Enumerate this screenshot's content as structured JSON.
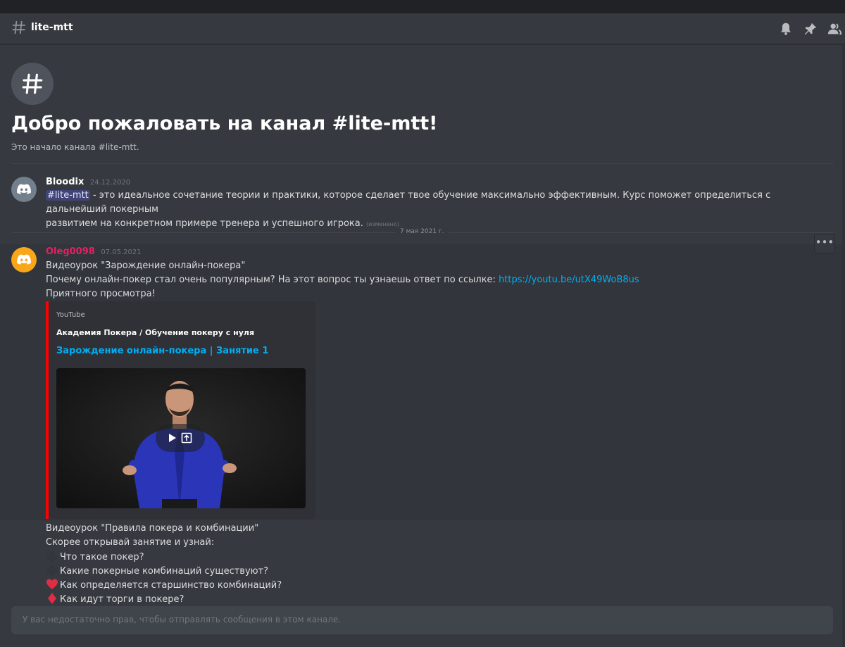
{
  "header": {
    "channel_name": "lite-mtt",
    "icons": [
      "hash-icon",
      "bell-icon",
      "pin-icon",
      "members-icon"
    ]
  },
  "welcome": {
    "title": "Добро пожаловать на канал #lite-mtt!",
    "subtitle": "Это начало канала #lite-mtt."
  },
  "messages": [
    {
      "author": "Bloodix",
      "author_color": "#ffffff",
      "avatar_color": "#747f8d",
      "timestamp": "24.12.2020",
      "mention": "#lite-mtt",
      "text_line1": " -  это идеальное сочетание теории и практики, которое сделает твое обучение максимально эффективным. Курс поможет определиться с дальнейший покерным",
      "text_line2": "развитием на конкретном примере тренера и успешного игрока.",
      "edited": "(изменено)"
    },
    {
      "author": "Oleg0098",
      "author_color": "#e91e63",
      "avatar_color": "#faa61a",
      "timestamp": "07.05.2021",
      "line1": "Видеоурок \"Зарождение онлайн-покера\"",
      "line2_prefix": "Почему онлайн-покер стал очень популярным? На этот вопрос ты узнаешь ответ по ссылке: ",
      "link": "https://youtu.be/utX49WoB8us",
      "line3": "Приятного просмотра!",
      "embed": {
        "provider": "YouTube",
        "author": "Академия Покера / Обучение покеру с нуля",
        "title": "Зарождение онлайн-покера | Занятие 1",
        "border_color": "#ff0000"
      },
      "line4": "Видеоурок \"Правила покера и комбинации\"",
      "line5": "Скорее открывай занятие и узнай:",
      "list": [
        {
          "emoji": "spade",
          "text": "Что такое покер?"
        },
        {
          "emoji": "club",
          "text": "Какие покерные комбинаций существуют?"
        },
        {
          "emoji": "heart",
          "text": "Как определяется старшинство комбинаций?"
        },
        {
          "emoji": "diamond",
          "text": "Как идут торги в покере?"
        }
      ]
    }
  ],
  "date_divider": "7 мая 2021 г.",
  "more_button": "•••",
  "input": {
    "placeholder": "У вас недостаточно прав, чтобы отправлять сообщения в этом канале."
  }
}
